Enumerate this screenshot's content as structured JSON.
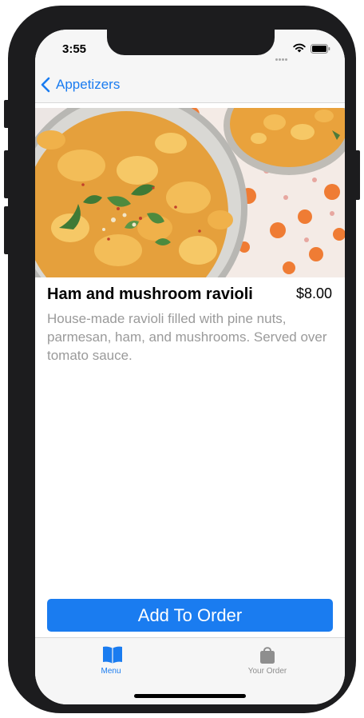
{
  "status_bar": {
    "time": "3:55"
  },
  "nav": {
    "back_label": "Appetizers"
  },
  "item": {
    "name": "Ham and mushroom ravioli",
    "price": "$8.00",
    "description": "House-made ravioli filled with pine nuts, parmesan, ham, and mushrooms. Served over tomato sauce."
  },
  "actions": {
    "add_label": "Add To Order"
  },
  "tab_bar": {
    "tabs": [
      {
        "label": "Menu",
        "icon": "book-icon",
        "selected": true
      },
      {
        "label": "Your Order",
        "icon": "bag-icon",
        "selected": false
      }
    ]
  },
  "colors": {
    "accent": "#1a7cf0",
    "inactive": "#8e8e8e",
    "description_text": "#9a9a9a"
  }
}
